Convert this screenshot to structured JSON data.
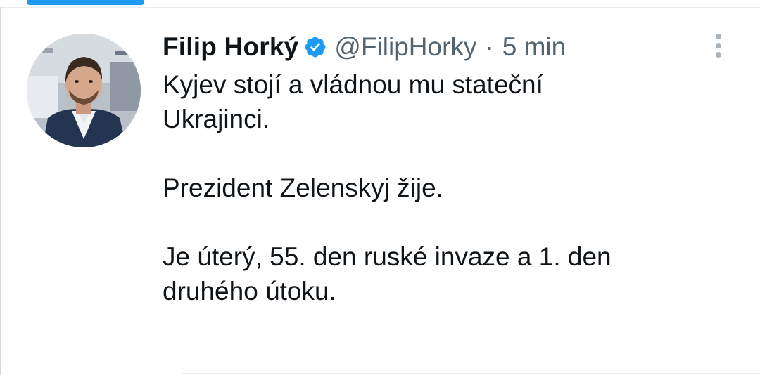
{
  "tweet": {
    "author": {
      "display_name": "Filip Horký",
      "handle": "@FilipHorky",
      "verified": true,
      "avatar_icon": "user-avatar-photo"
    },
    "separator": "·",
    "timestamp": "5 min",
    "text": {
      "para1_line1": "Kyjev stojí a vládnou mu stateční",
      "para1_line2": "Ukrajinci.",
      "para2": "Prezident Zelenskyj žije.",
      "para3_line1": "Je úterý, 55. den ruské invaze a 1. den",
      "para3_line2": "druhého útoku."
    },
    "more_icon": "more-vertical-icon"
  },
  "colors": {
    "accent": "#1d9bf0",
    "text_primary": "#0f1419",
    "text_secondary": "#536471",
    "divider": "#e6ecf0"
  }
}
